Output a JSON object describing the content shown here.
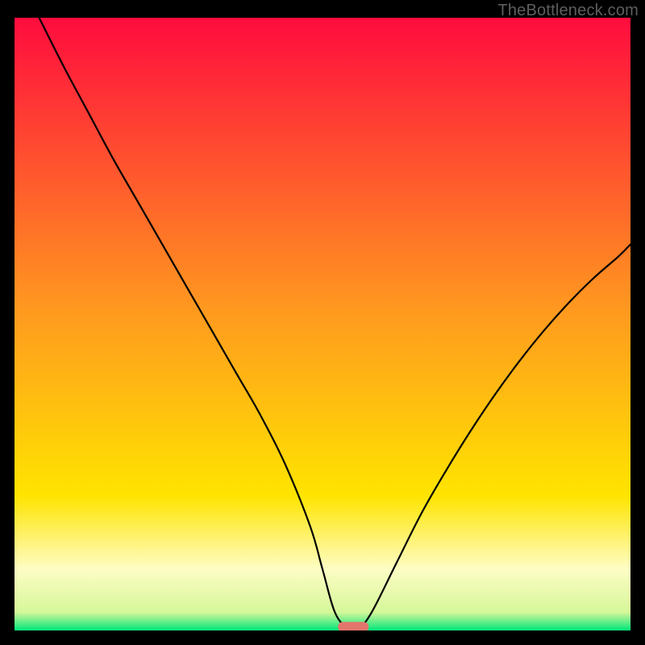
{
  "watermark": "TheBottleneck.com",
  "chart_data": {
    "type": "line",
    "title": "",
    "xlabel": "",
    "ylabel": "",
    "xlim": [
      0,
      100
    ],
    "ylim": [
      0,
      100
    ],
    "grid": false,
    "legend": false,
    "background": {
      "top_color": "#ff0c3e",
      "mid_color": "#ffe400",
      "band_color": "#fdfdc4",
      "bottom_color": "#00e67a"
    },
    "series": [
      {
        "name": "bottleneck-curve",
        "x": [
          4,
          8,
          12,
          16,
          20,
          24,
          28,
          32,
          36,
          40,
          44,
          48,
          50,
          52,
          54,
          56,
          58,
          62,
          66,
          70,
          74,
          78,
          82,
          86,
          90,
          94,
          98,
          100
        ],
        "y": [
          100,
          92,
          84.5,
          77,
          70,
          63,
          56,
          49,
          42,
          35,
          27,
          17,
          10,
          3,
          0.6,
          0.6,
          3,
          11,
          19,
          26,
          32.5,
          38.5,
          44,
          49,
          53.5,
          57.5,
          61,
          63
        ]
      }
    ],
    "marker": {
      "x": 55,
      "y": 0.6,
      "color": "#e2766c",
      "width": 5,
      "height": 1.6
    }
  }
}
